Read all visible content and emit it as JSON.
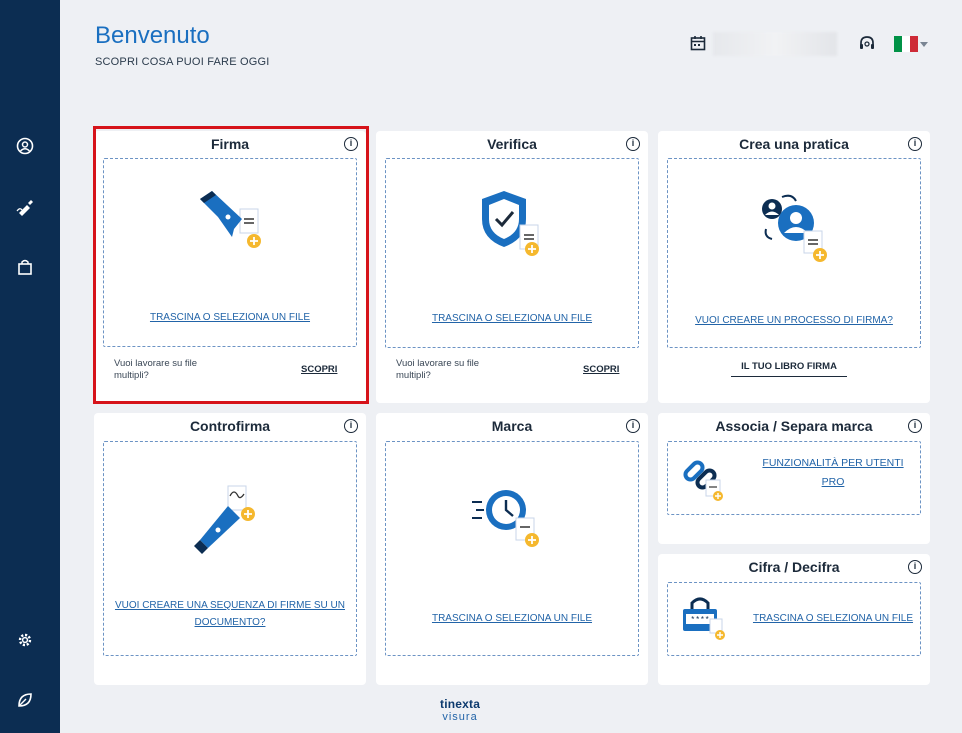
{
  "header": {
    "title": "Benvenuto",
    "subtitle": "SCOPRI COSA PUOI FARE OGGI"
  },
  "topbar": {
    "calendar_icon": "calendar-icon",
    "support_icon": "headset-icon",
    "language_flag": "italy-flag",
    "colors": {
      "flag_green": "#009246",
      "flag_white": "#ffffff",
      "flag_red": "#ce2b37"
    }
  },
  "sidebar": {
    "items": [
      {
        "icon": "user-circle-icon"
      },
      {
        "icon": "sign-pen-icon"
      },
      {
        "icon": "bag-icon"
      },
      {
        "icon": "gear-icon"
      },
      {
        "icon": "leaf-icon"
      }
    ]
  },
  "cards": {
    "firma": {
      "title": "Firma",
      "drop_link": "TRASCINA O SELEZIONA UN FILE",
      "multi_text": "Vuoi lavorare su file multipli?",
      "action": "SCOPRI"
    },
    "verifica": {
      "title": "Verifica",
      "drop_link": "TRASCINA O SELEZIONA UN FILE",
      "multi_text": "Vuoi lavorare su file multipli?",
      "action": "SCOPRI"
    },
    "crea": {
      "title": "Crea una pratica",
      "drop_link": "VUOI CREARE UN PROCESSO DI FIRMA?",
      "action": "IL TUO LIBRO FIRMA"
    },
    "controfirma": {
      "title": "Controfirma",
      "drop_link": "VUOI CREARE UNA SEQUENZA DI FIRME SU UN DOCUMENTO?"
    },
    "marca": {
      "title": "Marca",
      "drop_link": "TRASCINA O SELEZIONA UN FILE"
    },
    "associa": {
      "title": "Associa / Separa marca",
      "drop_link": "FUNZIONALITÀ PER UTENTI PRO"
    },
    "cifra": {
      "title": "Cifra / Decifra",
      "drop_link": "TRASCINA O SELEZIONA UN FILE",
      "password_mask": "****"
    }
  },
  "footer": {
    "logo_top": "tinexta",
    "logo_bottom": "visura"
  },
  "colors": {
    "sidebar": "#0c2d52",
    "accent": "#1a6fc0",
    "badge": "#f5b82e",
    "highlight": "#d6131a"
  }
}
